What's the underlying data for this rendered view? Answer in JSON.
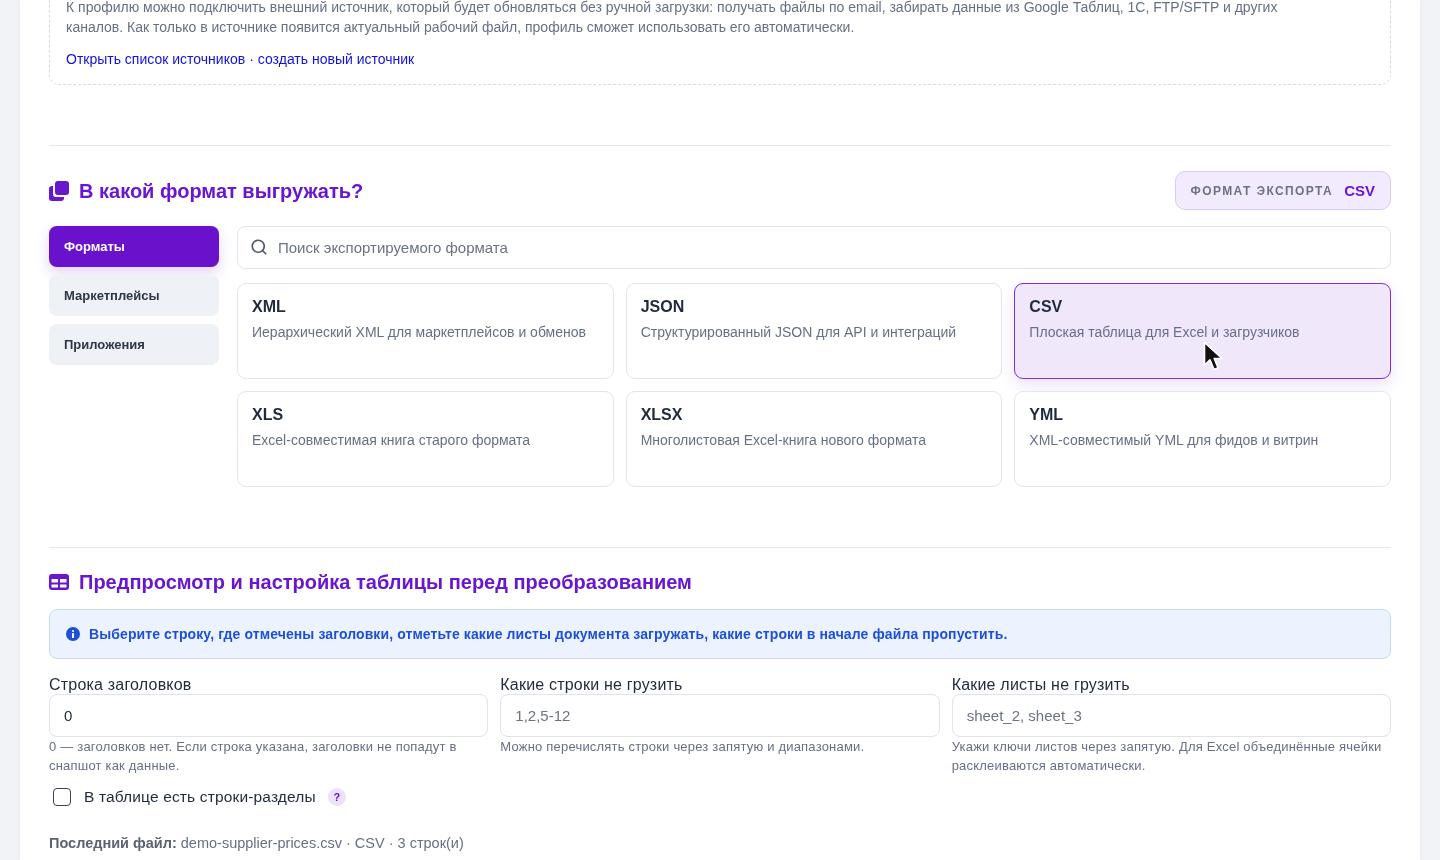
{
  "sources_note": {
    "text": "К профилю можно подключить внешний источник, который будет обновляться без ручной загрузки: получать файлы по email, забирать данные из Google Таблиц, 1С, FTP/SFTP и других каналов. Как только в источнике появится актуальный рабочий файл, профиль сможет использовать его автоматически.",
    "links": [
      "Открыть список источников",
      "создать новый источник"
    ],
    "link_separator": "·"
  },
  "format_section": {
    "title": "В какой формат выгружать?",
    "export_badge": {
      "label": "ФОРМАТ ЭКСПОРТА",
      "value": "CSV"
    },
    "nav": [
      {
        "label": "Форматы",
        "selected": true
      },
      {
        "label": "Маркетплейсы",
        "selected": false
      },
      {
        "label": "Приложения",
        "selected": false
      }
    ],
    "search": {
      "placeholder": "Поиск экспортируемого формата"
    },
    "formats": [
      {
        "name": "XML",
        "description": "Иерархический XML для маркетплейсов и обменов",
        "selected": false
      },
      {
        "name": "JSON",
        "description": "Структурированный JSON для API и интеграций",
        "selected": false
      },
      {
        "name": "CSV",
        "description": "Плоская таблица для Excel и загрузчиков",
        "selected": true
      },
      {
        "name": "XLS",
        "description": "Excel-совместимая книга старого формата",
        "selected": false
      },
      {
        "name": "XLSX",
        "description": "Многолистовая Excel-книга нового формата",
        "selected": false
      },
      {
        "name": "YML",
        "description": "XML-совместимый YML для фидов и витрин",
        "selected": false
      }
    ]
  },
  "preview_section": {
    "title": "Предпросмотр и настройка таблицы перед преобразованием",
    "info": "Выберите строку, где отмечены заголовки, отметьте какие листы документа загружать, какие строки в начале файла пропустить.",
    "fields": [
      {
        "label": "Строка заголовков",
        "value": "0",
        "help": "0 — заголовков нет. Если строка указана, заголовки не попадут в снапшот как данные."
      },
      {
        "label": "Какие строки не грузить",
        "placeholder": "1,2,5-12",
        "help": "Можно перечислять строки через запятую и диапазонами."
      },
      {
        "label": "Какие листы не грузить",
        "placeholder": "sheet_2, sheet_3",
        "help": "Укажи ключи листов через запятую. Для Excel объединённые ячейки расклеиваются автоматически."
      }
    ],
    "sections_checkbox": {
      "label": "В таблице есть строки-разделы",
      "checked": false,
      "help_mark": "?"
    },
    "last_file": "**Последний файл:** demo-supplier-prices.csv · CSV · 3 строк(и)"
  }
}
